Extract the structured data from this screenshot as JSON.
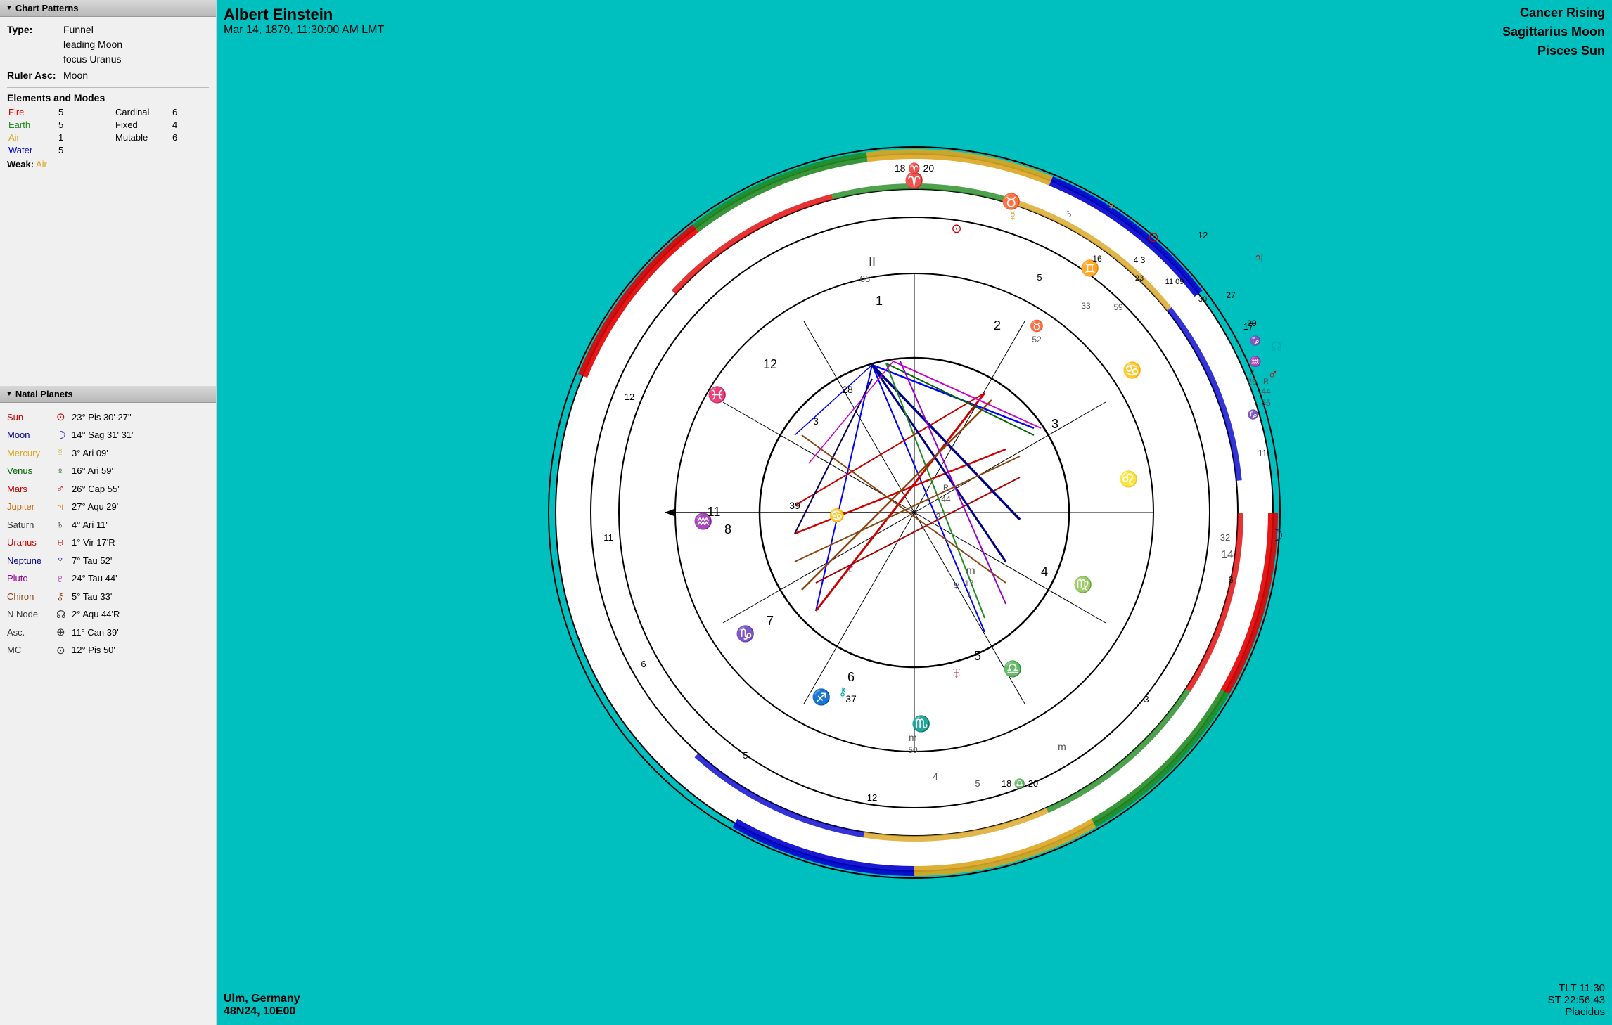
{
  "leftPanel": {
    "chartPatterns": {
      "header": "Chart Patterns",
      "type_label": "Type:",
      "type_value": "Funnel",
      "type_line2": "leading Moon",
      "type_line3": "focus Uranus",
      "ruler_label": "Ruler Asc:",
      "ruler_value": "Moon"
    },
    "elementsAndModes": {
      "title": "Elements and Modes",
      "rows": [
        {
          "name": "Fire",
          "color": "fire",
          "count": "5",
          "mode": "Cardinal",
          "modeCount": "6"
        },
        {
          "name": "Earth",
          "color": "earth",
          "count": "5",
          "mode": "Fixed",
          "modeCount": "4"
        },
        {
          "name": "Air",
          "color": "air",
          "count": "1",
          "mode": "Mutable",
          "modeCount": "6"
        },
        {
          "name": "Water",
          "color": "water",
          "count": "5",
          "mode": "",
          "modeCount": ""
        }
      ],
      "weak_label": "Weak:",
      "weak_value": "Air"
    },
    "natalPlanets": {
      "header": "Natal Planets",
      "planets": [
        {
          "name": "Sun",
          "color": "sun",
          "symbol": "⊙",
          "position": "23° Pis 30' 27\""
        },
        {
          "name": "Moon",
          "color": "moon",
          "symbol": "☽",
          "position": "14° Sag 31' 31\""
        },
        {
          "name": "Mercury",
          "color": "mercury",
          "symbol": "☿",
          "position": "3° Ari 09'"
        },
        {
          "name": "Venus",
          "color": "venus",
          "symbol": "♀",
          "position": "16° Ari 59'"
        },
        {
          "name": "Mars",
          "color": "mars",
          "symbol": "♂",
          "position": "26° Cap 55'"
        },
        {
          "name": "Jupiter",
          "color": "jupiter",
          "symbol": "♃",
          "position": "27° Aqu 29'"
        },
        {
          "name": "Saturn",
          "color": "saturn",
          "symbol": "♄",
          "position": "4° Ari 11'"
        },
        {
          "name": "Uranus",
          "color": "uranus",
          "symbol": "♅",
          "position": "1° Vir 17'R"
        },
        {
          "name": "Neptune",
          "color": "neptune",
          "symbol": "♆",
          "position": "7° Tau 52'"
        },
        {
          "name": "Pluto",
          "color": "pluto",
          "symbol": "♇",
          "position": "24° Tau 44'"
        },
        {
          "name": "Chiron",
          "color": "chiron",
          "symbol": "⚷",
          "position": "5° Tau 33'"
        },
        {
          "name": "N Node",
          "color": "saturn",
          "symbol": "☊",
          "position": "2° Aqu 44'R"
        },
        {
          "name": "Asc.",
          "color": "saturn",
          "symbol": "⊕",
          "position": "11° Can 39'"
        },
        {
          "name": "MC",
          "color": "saturn",
          "symbol": "⊙",
          "position": "12° Pis 50'"
        }
      ]
    }
  },
  "chart": {
    "title": "Albert Einstein",
    "date": "Mar 14, 1879, 11:30:00 AM LMT",
    "topRight": {
      "line1": "Cancer Rising",
      "line2": "Sagittarius Moon",
      "line3": "Pisces Sun"
    },
    "bottomLeft": {
      "line1": "Ulm, Germany",
      "line2": "48N24, 10E00"
    },
    "bottomRight": {
      "tlt": "TLT 11:30",
      "st": "ST 22:56:43",
      "system": "Placidus"
    }
  }
}
